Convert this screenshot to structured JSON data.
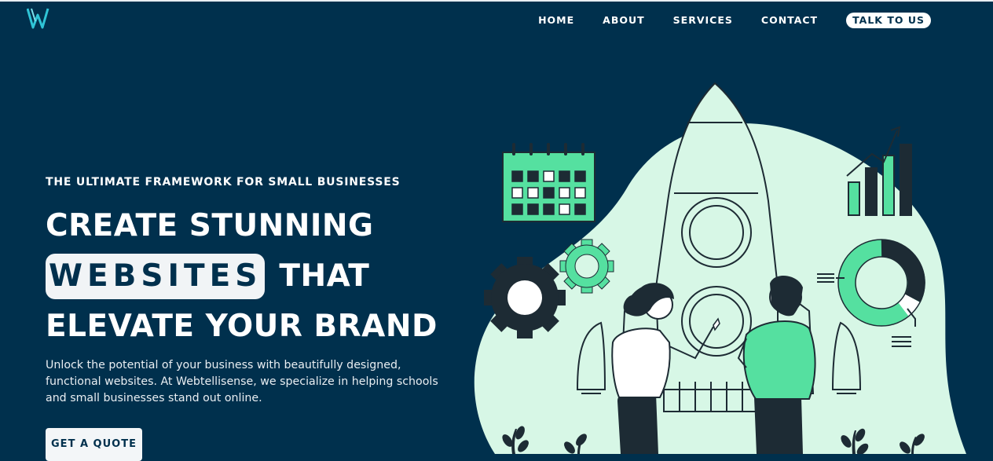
{
  "nav": {
    "items": [
      "HOME",
      "ABOUT",
      "SERVICES",
      "CONTACT"
    ],
    "cta_label": "TALK TO US"
  },
  "hero": {
    "eyebrow": "THE ULTIMATE FRAMEWORK FOR SMALL BUSINESSES",
    "headline_line1": "CREATE STUNNING",
    "headline_highlight": "WEBSITES",
    "headline_line2_rest": "THAT",
    "headline_line3": "ELEVATE YOUR BRAND",
    "description": "Unlock the potential of your business with beautifully designed, functional websites. At Webtellisense, we specialize in helping schools and small businesses stand out online.",
    "button_label": "GET A QUOTE"
  },
  "colors": {
    "background": "#00304d",
    "accent_green": "#55e0a0",
    "blob": "#d7f7e6",
    "dark": "#1d2b34"
  },
  "icons": [
    "webtellisense-logo-icon",
    "calendar-icon",
    "gear-icon",
    "rocket-icon",
    "bar-chart-icon",
    "donut-chart-icon",
    "plant-icon"
  ]
}
